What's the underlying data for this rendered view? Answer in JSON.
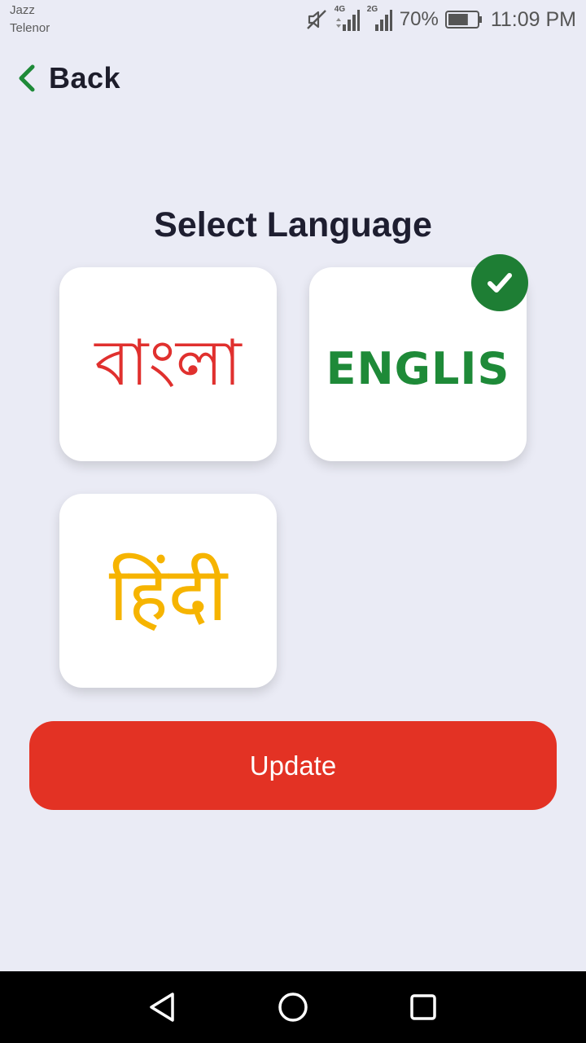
{
  "status_bar": {
    "carrier_1": "Jazz",
    "carrier_2": "Telenor",
    "network_1": "4G",
    "network_2": "2G",
    "battery": "70%",
    "battery_level": 0.7,
    "time": "11:09 PM",
    "icons": [
      "mute-icon",
      "signal-icon",
      "signal-icon",
      "battery-icon"
    ]
  },
  "header": {
    "back_label": "Back",
    "back_icon": "chevron-left-icon",
    "accent_color": "#1e8a38"
  },
  "page": {
    "title": "Select Language"
  },
  "languages": [
    {
      "label": "বাংলা",
      "color": "#e0302e",
      "selected": false
    },
    {
      "label": "ENGLIS",
      "color": "#1e8a38",
      "selected": true
    },
    {
      "label": "हिंदी",
      "color": "#f6b400",
      "selected": false
    }
  ],
  "selected_icon": "check-icon",
  "update_button": {
    "label": "Update",
    "color": "#e33224"
  },
  "nav_bar": {
    "icons": [
      "back-triangle-icon",
      "home-circle-icon",
      "recents-square-icon"
    ]
  }
}
